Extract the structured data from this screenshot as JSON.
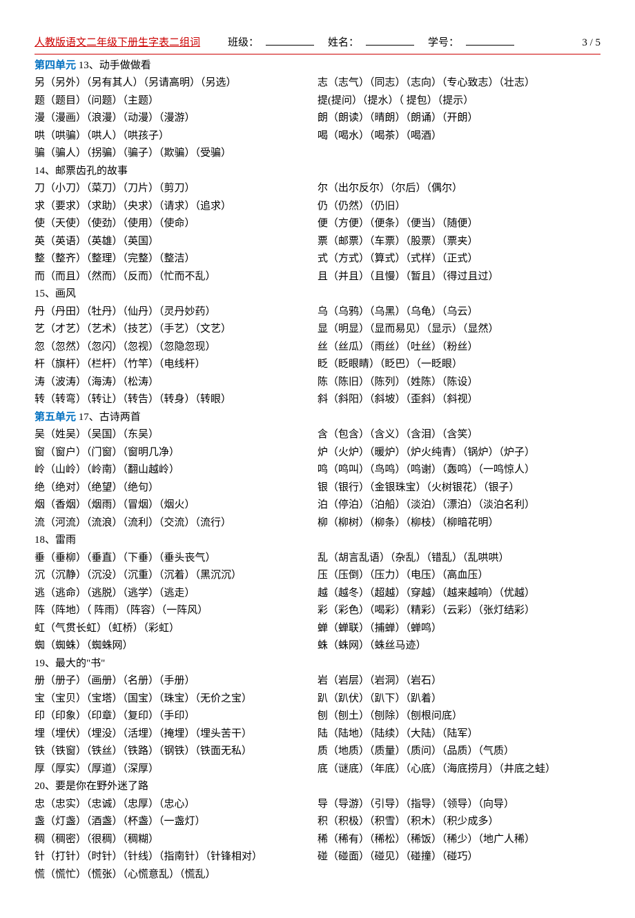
{
  "header": {
    "title": "人教版语文二年级下册生字表二组词",
    "class_label": "班级：",
    "name_label": "姓名：",
    "id_label": "学号：",
    "page": "3 / 5"
  },
  "sections": [
    {
      "unit": "第四单元",
      "lesson": "13、动手做做看",
      "rows": [
        {
          "l": "另（另外）（另有其人）（另请高明）（另选）",
          "r": "志（志气）（同志）（志向）（专心致志）（壮志）"
        },
        {
          "l": "题（题目）（问题）（主题）",
          "r": "提(提问）（提水）（ 提包）（提示）"
        },
        {
          "l": "漫（漫画）（浪漫）（动漫）（漫游）",
          "r": "朗（朗读）（晴朗）（朗诵）（开朗）"
        },
        {
          "l": "哄（哄骗）（哄人）（哄孩子）",
          "r": "喝（喝水）（喝茶）（喝酒）"
        },
        {
          "l": "骗（骗人）（拐骗）（骗子）（欺骗）（受骗）",
          "r": ""
        }
      ]
    },
    {
      "lesson": "14、邮票齿孔的故事",
      "rows": [
        {
          "l": "刀（小刀）（菜刀）（刀片）（剪刀）",
          "r": "尔（出尔反尔）（尔后）（偶尔）"
        },
        {
          "l": "求（要求）（求助）（央求）（请求）（追求）",
          "r": "仍（仍然）（仍旧）"
        },
        {
          "l": "使（天使）（使劲）（使用）（使命）",
          "r": "便（方便）（便条）（便当）（随便）"
        },
        {
          "l": "英（英语）（英雄）（英国）",
          "r": "票（邮票）（车票）（股票）（票夹）"
        },
        {
          "l": "整（整齐）（整理）（完整）（整洁）",
          "r": "式（方式）（算式）（式样）（正式）"
        },
        {
          "l": "而（而且）（然而）（反而）（忙而不乱）",
          "r": "且（并且）（且慢）（暂且）（得过且过）"
        }
      ]
    },
    {
      "lesson": "15、画风",
      "rows": [
        {
          "l": "丹（丹田）（牡丹）（仙丹）（灵丹妙药）",
          "r": "乌（乌鸦）（乌黑）（乌龟）（乌云）"
        },
        {
          "l": "艺（才艺）（艺术）（技艺）（手艺）（文艺）",
          "r": "显（明显）（显而易见）（显示）（显然）"
        },
        {
          "l": "忽（忽然）（忽闪）（忽视）（忽隐忽现）",
          "r": "丝（丝瓜）（雨丝）（吐丝）（粉丝）"
        },
        {
          "l": "杆（旗杆）（栏杆）（竹竿）（电线杆）",
          "r": "眨（眨眼睛）（眨巴）（一眨眼）"
        },
        {
          "l": "涛（波涛）（海涛）（松涛）",
          "r": "陈（陈旧）（陈列）（姓陈）（陈设）"
        },
        {
          "l": "转（转弯）（转让）（转告）（转身）（转眼）",
          "r": "斜（斜阳）（斜坡）（歪斜）（斜视）"
        }
      ]
    },
    {
      "unit": "第五单元",
      "lesson": "17、古诗两首",
      "rows": [
        {
          "l": "吴（姓吴）（吴国）（东吴）",
          "r": "含（包含）（含义）（含泪）（含笑）"
        },
        {
          "l": "窗（窗户）（门窗）（窗明几净）",
          "r": "炉（火炉）（暖炉）（炉火纯青）（锅炉）（炉子）"
        },
        {
          "l": "岭（山岭）（岭南）（翻山越岭）",
          "r": "鸣（鸣叫）（鸟鸣）（鸣谢）（轰鸣）（一鸣惊人）"
        },
        {
          "l": "绝（绝对）（绝望）（绝句）",
          "r": "银（银行）（金银珠宝）（火树银花）（银子）"
        },
        {
          "l": "烟（香烟）（烟雨）（冒烟）（烟火）",
          "r": "泊（停泊）（泊船）（淡泊）（漂泊）（淡泊名利）"
        },
        {
          "l": "流（河流）（流浪）（流利）（交流）（流行）",
          "r": "柳（柳树）（柳条）（柳枝）（柳暗花明）"
        }
      ]
    },
    {
      "lesson": "18、雷雨",
      "rows": [
        {
          "l": "垂（垂柳）（垂直）（下垂）（垂头丧气）",
          "r": "乱（胡言乱语）（杂乱）（错乱）（乱哄哄）"
        },
        {
          "l": "沉（沉静）（沉没）（沉重）（沉着）（黑沉沉）",
          "r": "压（压倒）（压力）（电压）（高血压）"
        },
        {
          "l": "逃（逃命）（逃脱）（逃学）（逃走）",
          "r": "越（越冬）（超越）（穿越）（越来越响）（优越）"
        },
        {
          "l": "阵（阵地）（ 阵雨）（阵容）（一阵风）",
          "r": "彩（彩色）（喝彩）（精彩）（云彩）（张灯结彩）"
        },
        {
          "l": "虹（气贯长虹）（虹桥）（彩虹）",
          "r": "蝉（蝉联）（捕蝉）（蝉鸣）"
        },
        {
          "l": "蜘（蜘蛛）（蜘蛛网）",
          "r": "蛛（蛛网）（蛛丝马迹）"
        }
      ]
    },
    {
      "lesson": "19、最大的\"书\"",
      "rows": [
        {
          "l": "册（册子）（画册）（名册）（手册）",
          "r": "岩（岩层）（岩洞）（岩石）"
        },
        {
          "l": "宝（宝贝）（宝塔）（国宝）（珠宝）（无价之宝）",
          "r": "趴（趴伏）（趴下）（趴着）"
        },
        {
          "l": "印（印象）（印章）（复印）（手印）",
          "r": "刨（刨土）（刨除）（刨根问底）"
        },
        {
          "l": "埋（埋伏）（埋没）（活埋）（掩埋）（埋头苦干）",
          "r": "陆（陆地）（陆续）（大陆）（陆军）"
        },
        {
          "l": "铁（铁窗）（铁丝）（铁路）（钢铁）（铁面无私）",
          "r": "质（地质）（质量）（质问）（品质）（气质）"
        },
        {
          "l": "厚（厚实）（厚道）（深厚）",
          "r": "底（谜底）（年底）（心底）（海底捞月）（井底之蛙）"
        }
      ]
    },
    {
      "lesson": "20、要是你在野外迷了路",
      "rows": [
        {
          "l": "忠（忠实）（忠诚）（忠厚）（忠心）",
          "r": "导（导游）（引导）（指导）（领导）（向导）"
        },
        {
          "l": "盏（灯盏）（酒盏）（杯盏）（一盏灯）",
          "r": "积（积极）（积雪）（积木）（积少成多）"
        },
        {
          "l": "稠（稠密）（很稠）（稠糊）",
          "r": "稀（稀有）（稀松）（稀饭）（稀少）（地广人稀）"
        },
        {
          "l": "针（打针）（时针）（针线）（指南针）（针锋相对）",
          "r": "碰（碰面）（碰见）（碰撞）（碰巧）"
        },
        {
          "l": "慌（慌忙）（慌张）（心慌意乱）（慌乱）",
          "r": ""
        }
      ]
    }
  ]
}
